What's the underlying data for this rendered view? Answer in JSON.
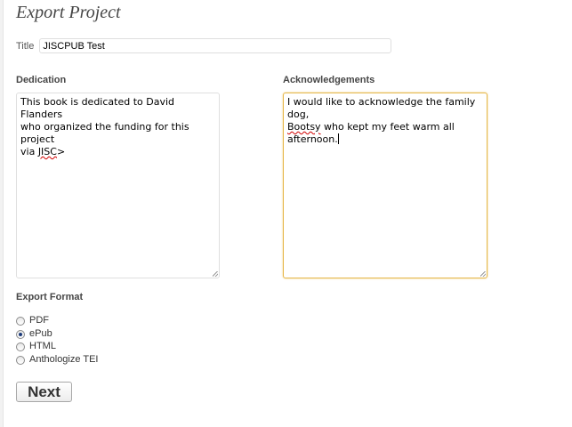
{
  "page": {
    "title": "Export Project"
  },
  "title_field": {
    "label": "Title",
    "value": "JISCPUB Test"
  },
  "dedication": {
    "heading": "Dedication",
    "text_before": "This book is dedicated to David Flanders\nwho organized the funding for this project\nvia ",
    "misspelled": "JISC",
    "text_after": ">"
  },
  "acknowledgements": {
    "heading": "Acknowledgements",
    "line1": "I would like to acknowledge the family dog,\n",
    "misspelled": "Bootsy",
    "text_after": " who kept my feet warm all\nafternoon."
  },
  "export_format": {
    "heading": "Export Format",
    "options": [
      {
        "label": "PDF",
        "checked": false
      },
      {
        "label": "ePub",
        "checked": true
      },
      {
        "label": "HTML",
        "checked": false
      },
      {
        "label": "Anthologize TEI",
        "checked": false
      }
    ]
  },
  "actions": {
    "next_label": "Next"
  }
}
